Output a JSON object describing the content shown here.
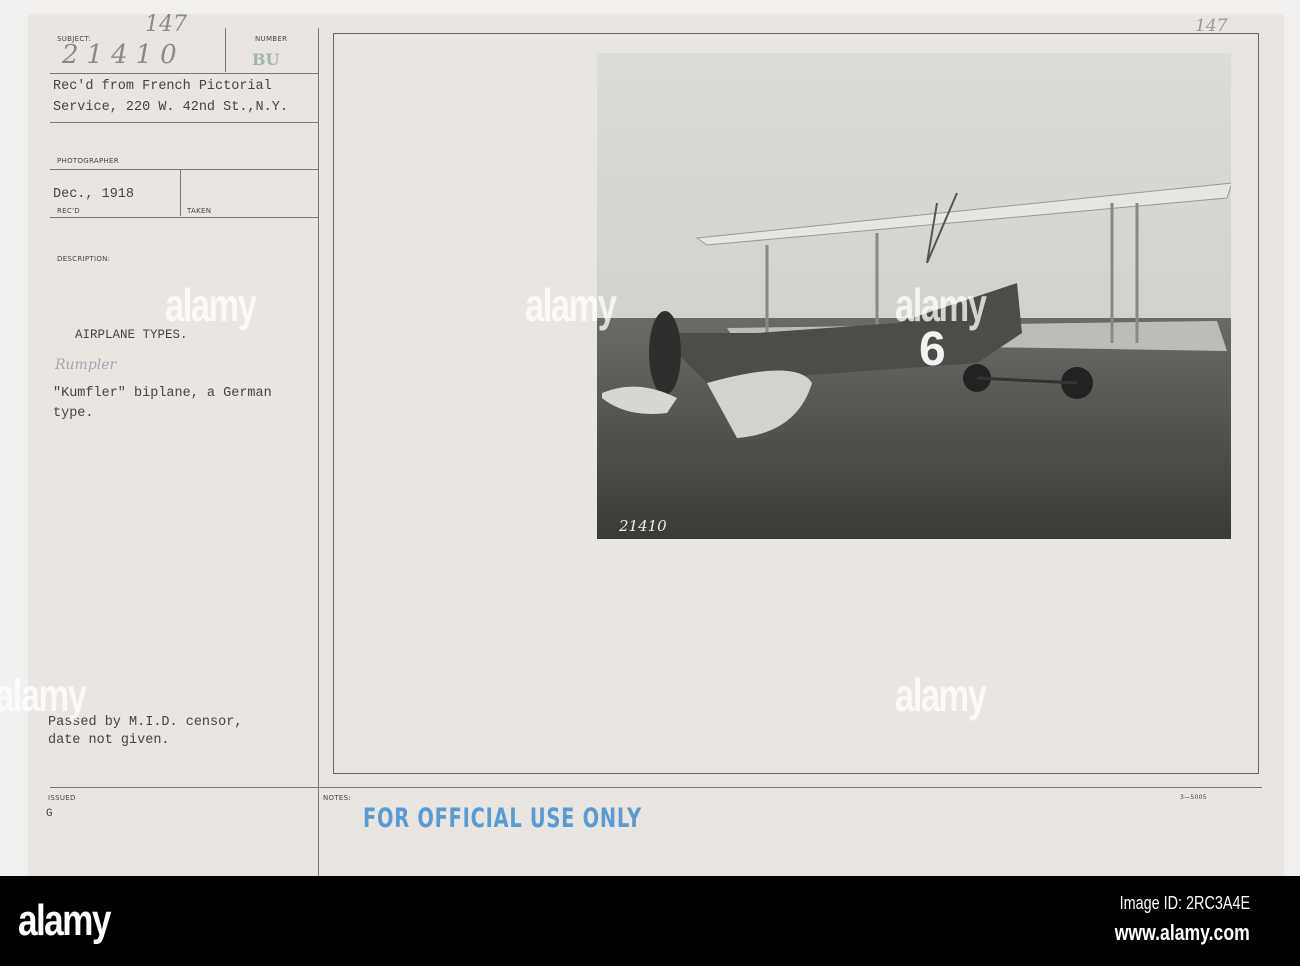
{
  "card": {
    "subject_label": "SUBJECT:",
    "number_label": "NUMBER",
    "handwritten_top": "147",
    "handwritten_subject": "21410",
    "number_stamp": "BU",
    "received_from_line1": "Rec'd from French Pictorial",
    "received_from_line2": "Service, 220 W. 42nd St.,N.Y.",
    "photographer_label": "PHOTOGRAPHER",
    "recd_date": "Dec., 1918",
    "recd_label": "REC'D",
    "taken_label": "TAKEN",
    "description_label": "DESCRIPTION:",
    "description_title": "AIRPLANE TYPES.",
    "handwritten_correction": "Rumpler",
    "description_line1": "\"Kumfler\" biplane, a German",
    "description_line2": "type.",
    "censor_line1": "Passed by M.I.D. censor,",
    "censor_line2": "date not given.",
    "issued_label": "ISSUED",
    "issued_value": "G",
    "notes_label": "NOTES:",
    "stamp": "FOR OFFICIAL USE ONLY",
    "form_number": "3—5005",
    "corner_handwritten": "147"
  },
  "photo": {
    "plane_number": "6",
    "negative_number": "21410"
  },
  "watermark": {
    "logo": "alamy",
    "image_id": "Image ID: 2RC3A4E",
    "website": "www.alamy.com"
  }
}
